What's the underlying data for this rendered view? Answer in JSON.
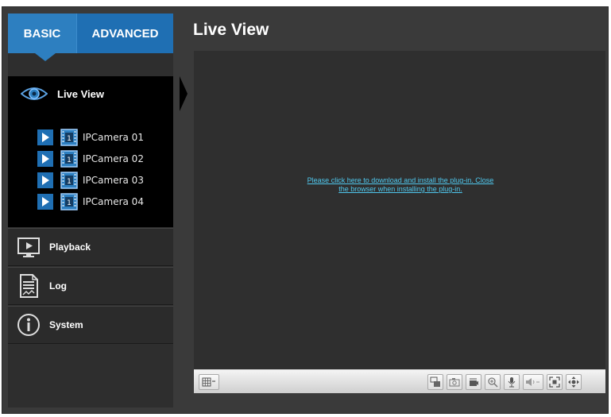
{
  "tabs": {
    "basic": "BASIC",
    "advanced": "ADVANCED"
  },
  "sidebar": {
    "live_view": {
      "label": "Live View",
      "cameras": [
        "IPCamera 01",
        "IPCamera 02",
        "IPCamera 03",
        "IPCamera 04"
      ]
    },
    "items": [
      {
        "label": "Playback",
        "icon": "playback-icon"
      },
      {
        "label": "Log",
        "icon": "log-icon"
      },
      {
        "label": "System",
        "icon": "system-info-icon"
      }
    ]
  },
  "main": {
    "title": "Live View",
    "plugin_message": "Please click here to download and install the plug-in. Close the browser when installing the plug-in."
  },
  "toolbar": {
    "icons": [
      "layout-icon",
      "stream-icon",
      "snapshot-icon",
      "record-icon",
      "zoom-icon",
      "microphone-icon",
      "volume-icon",
      "fullscreen-icon",
      "ptz-icon"
    ]
  },
  "colors": {
    "accent": "#2d7fc0",
    "link": "#4fc8ee",
    "background": "#3a3a3a"
  }
}
